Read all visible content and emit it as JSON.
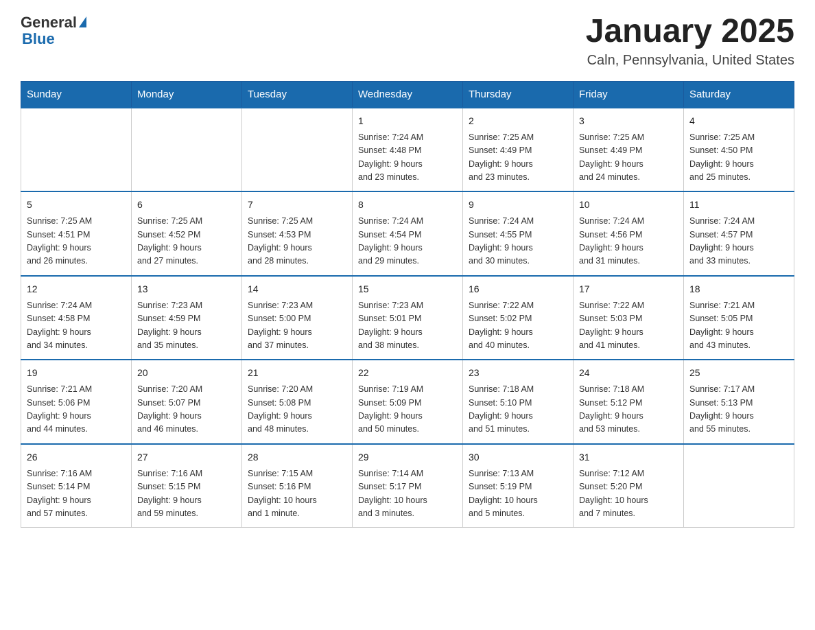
{
  "header": {
    "logo_general": "General",
    "logo_triangle": "▶",
    "logo_blue": "Blue",
    "title": "January 2025",
    "subtitle": "Caln, Pennsylvania, United States"
  },
  "weekdays": [
    "Sunday",
    "Monday",
    "Tuesday",
    "Wednesday",
    "Thursday",
    "Friday",
    "Saturday"
  ],
  "weeks": [
    [
      {
        "day": "",
        "info": ""
      },
      {
        "day": "",
        "info": ""
      },
      {
        "day": "",
        "info": ""
      },
      {
        "day": "1",
        "info": "Sunrise: 7:24 AM\nSunset: 4:48 PM\nDaylight: 9 hours\nand 23 minutes."
      },
      {
        "day": "2",
        "info": "Sunrise: 7:25 AM\nSunset: 4:49 PM\nDaylight: 9 hours\nand 23 minutes."
      },
      {
        "day": "3",
        "info": "Sunrise: 7:25 AM\nSunset: 4:49 PM\nDaylight: 9 hours\nand 24 minutes."
      },
      {
        "day": "4",
        "info": "Sunrise: 7:25 AM\nSunset: 4:50 PM\nDaylight: 9 hours\nand 25 minutes."
      }
    ],
    [
      {
        "day": "5",
        "info": "Sunrise: 7:25 AM\nSunset: 4:51 PM\nDaylight: 9 hours\nand 26 minutes."
      },
      {
        "day": "6",
        "info": "Sunrise: 7:25 AM\nSunset: 4:52 PM\nDaylight: 9 hours\nand 27 minutes."
      },
      {
        "day": "7",
        "info": "Sunrise: 7:25 AM\nSunset: 4:53 PM\nDaylight: 9 hours\nand 28 minutes."
      },
      {
        "day": "8",
        "info": "Sunrise: 7:24 AM\nSunset: 4:54 PM\nDaylight: 9 hours\nand 29 minutes."
      },
      {
        "day": "9",
        "info": "Sunrise: 7:24 AM\nSunset: 4:55 PM\nDaylight: 9 hours\nand 30 minutes."
      },
      {
        "day": "10",
        "info": "Sunrise: 7:24 AM\nSunset: 4:56 PM\nDaylight: 9 hours\nand 31 minutes."
      },
      {
        "day": "11",
        "info": "Sunrise: 7:24 AM\nSunset: 4:57 PM\nDaylight: 9 hours\nand 33 minutes."
      }
    ],
    [
      {
        "day": "12",
        "info": "Sunrise: 7:24 AM\nSunset: 4:58 PM\nDaylight: 9 hours\nand 34 minutes."
      },
      {
        "day": "13",
        "info": "Sunrise: 7:23 AM\nSunset: 4:59 PM\nDaylight: 9 hours\nand 35 minutes."
      },
      {
        "day": "14",
        "info": "Sunrise: 7:23 AM\nSunset: 5:00 PM\nDaylight: 9 hours\nand 37 minutes."
      },
      {
        "day": "15",
        "info": "Sunrise: 7:23 AM\nSunset: 5:01 PM\nDaylight: 9 hours\nand 38 minutes."
      },
      {
        "day": "16",
        "info": "Sunrise: 7:22 AM\nSunset: 5:02 PM\nDaylight: 9 hours\nand 40 minutes."
      },
      {
        "day": "17",
        "info": "Sunrise: 7:22 AM\nSunset: 5:03 PM\nDaylight: 9 hours\nand 41 minutes."
      },
      {
        "day": "18",
        "info": "Sunrise: 7:21 AM\nSunset: 5:05 PM\nDaylight: 9 hours\nand 43 minutes."
      }
    ],
    [
      {
        "day": "19",
        "info": "Sunrise: 7:21 AM\nSunset: 5:06 PM\nDaylight: 9 hours\nand 44 minutes."
      },
      {
        "day": "20",
        "info": "Sunrise: 7:20 AM\nSunset: 5:07 PM\nDaylight: 9 hours\nand 46 minutes."
      },
      {
        "day": "21",
        "info": "Sunrise: 7:20 AM\nSunset: 5:08 PM\nDaylight: 9 hours\nand 48 minutes."
      },
      {
        "day": "22",
        "info": "Sunrise: 7:19 AM\nSunset: 5:09 PM\nDaylight: 9 hours\nand 50 minutes."
      },
      {
        "day": "23",
        "info": "Sunrise: 7:18 AM\nSunset: 5:10 PM\nDaylight: 9 hours\nand 51 minutes."
      },
      {
        "day": "24",
        "info": "Sunrise: 7:18 AM\nSunset: 5:12 PM\nDaylight: 9 hours\nand 53 minutes."
      },
      {
        "day": "25",
        "info": "Sunrise: 7:17 AM\nSunset: 5:13 PM\nDaylight: 9 hours\nand 55 minutes."
      }
    ],
    [
      {
        "day": "26",
        "info": "Sunrise: 7:16 AM\nSunset: 5:14 PM\nDaylight: 9 hours\nand 57 minutes."
      },
      {
        "day": "27",
        "info": "Sunrise: 7:16 AM\nSunset: 5:15 PM\nDaylight: 9 hours\nand 59 minutes."
      },
      {
        "day": "28",
        "info": "Sunrise: 7:15 AM\nSunset: 5:16 PM\nDaylight: 10 hours\nand 1 minute."
      },
      {
        "day": "29",
        "info": "Sunrise: 7:14 AM\nSunset: 5:17 PM\nDaylight: 10 hours\nand 3 minutes."
      },
      {
        "day": "30",
        "info": "Sunrise: 7:13 AM\nSunset: 5:19 PM\nDaylight: 10 hours\nand 5 minutes."
      },
      {
        "day": "31",
        "info": "Sunrise: 7:12 AM\nSunset: 5:20 PM\nDaylight: 10 hours\nand 7 minutes."
      },
      {
        "day": "",
        "info": ""
      }
    ]
  ]
}
